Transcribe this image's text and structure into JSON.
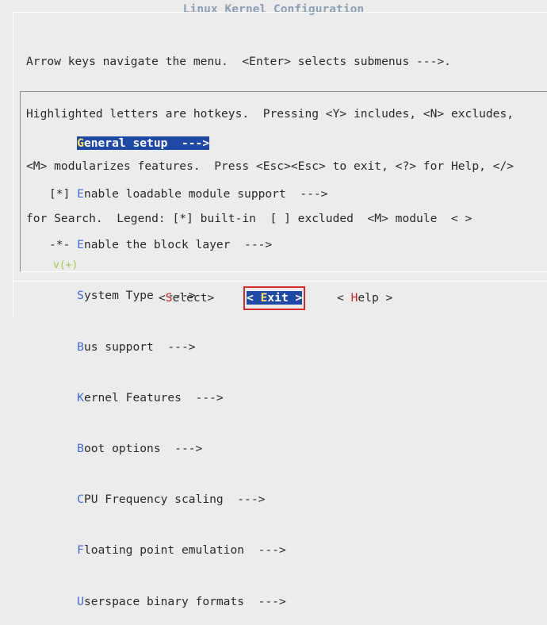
{
  "window": {
    "title": "Linux Kernel Configuration"
  },
  "help": {
    "lines": [
      "Arrow keys navigate the menu.  <Enter> selects submenus --->.",
      "Highlighted letters are hotkeys.  Pressing <Y> includes, <N> excludes,",
      "<M> modularizes features.  Press <Esc><Esc> to exit, <?> for Help, </>",
      "for Search.  Legend: [*] built-in  [ ] excluded  <M> module  < >"
    ]
  },
  "menu": {
    "items": [
      {
        "prefix": "    ",
        "hotkey": "G",
        "rest": "eneral setup  --->",
        "selected": true
      },
      {
        "prefix": "[*] ",
        "hotkey": "E",
        "rest": "nable loadable module support  --->"
      },
      {
        "prefix": "-*- ",
        "hotkey": "E",
        "rest": "nable the block layer  --->"
      },
      {
        "prefix": "    ",
        "hotkey": "S",
        "rest": "ystem Type  --->"
      },
      {
        "prefix": "    ",
        "hotkey": "B",
        "rest": "us support  --->"
      },
      {
        "prefix": "    ",
        "hotkey": "K",
        "rest": "ernel Features  --->"
      },
      {
        "prefix": "    ",
        "hotkey": "B",
        "rest": "oot options  --->"
      },
      {
        "prefix": "    ",
        "hotkey": "C",
        "rest": "PU Frequency scaling  --->"
      },
      {
        "prefix": "    ",
        "hotkey": "F",
        "rest": "loating point emulation  --->"
      },
      {
        "prefix": "    ",
        "hotkey": "U",
        "rest": "serspace binary formats  --->"
      }
    ],
    "more_indicator": "v(+)"
  },
  "buttons": {
    "select": {
      "open": "<",
      "hotkey": "S",
      "rest": "elect",
      "close": ">"
    },
    "exit": {
      "open": "< ",
      "hotkey": "E",
      "rest": "xit",
      "close": " >"
    },
    "help": {
      "open": "< ",
      "hotkey": "H",
      "rest": "elp",
      "close": " >"
    }
  },
  "colors": {
    "background": "#ececec",
    "selection": "#1f49a6",
    "hotkey": "#3b6bd6",
    "button_hotkey": "#d42020",
    "focus_outline": "#d62a2a"
  }
}
